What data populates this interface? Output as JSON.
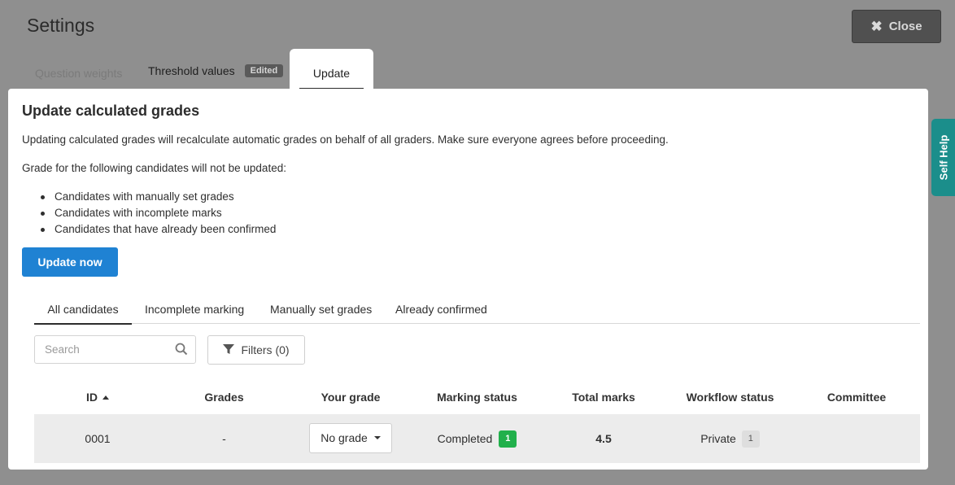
{
  "header": {
    "title": "Settings",
    "close_label": "Close"
  },
  "top_tabs": [
    {
      "label": "Question weights"
    },
    {
      "label": "Threshold values",
      "badge": "Edited"
    },
    {
      "label": "Update",
      "active": true
    }
  ],
  "self_help": {
    "label": "Self Help"
  },
  "panel": {
    "title": "Update calculated grades",
    "description": "Updating calculated grades will recalculate automatic grades on behalf of all graders. Make sure everyone agrees before proceeding.",
    "exclusion_intro": "Grade for the following candidates will not be updated:",
    "exclusions": [
      "Candidates with manually set grades",
      "Candidates with incomplete marks",
      "Candidates that have already been confirmed"
    ],
    "update_button": "Update now"
  },
  "sub_tabs": [
    {
      "label": "All candidates",
      "active": true
    },
    {
      "label": "Incomplete marking"
    },
    {
      "label": "Manually set grades"
    },
    {
      "label": "Already confirmed"
    }
  ],
  "search": {
    "placeholder": "Search",
    "value": ""
  },
  "filters": {
    "label": "Filters (0)"
  },
  "table": {
    "columns": [
      "ID",
      "Grades",
      "Your grade",
      "Marking status",
      "Total marks",
      "Workflow status",
      "Committee"
    ],
    "sort_column": "ID",
    "sort_direction": "ascending",
    "rows": [
      {
        "id": "0001",
        "grades": "-",
        "your_grade": "No grade",
        "marking_status": "Completed",
        "marking_count": "1",
        "total_marks": "4.5",
        "workflow_status": "Private",
        "workflow_count": "1",
        "committee": ""
      }
    ]
  },
  "colors": {
    "primary_button": "#1f82d3",
    "self_help": "#1b8e8b",
    "completed_badge": "#21b04b",
    "overlay": "#8f8f8f"
  }
}
